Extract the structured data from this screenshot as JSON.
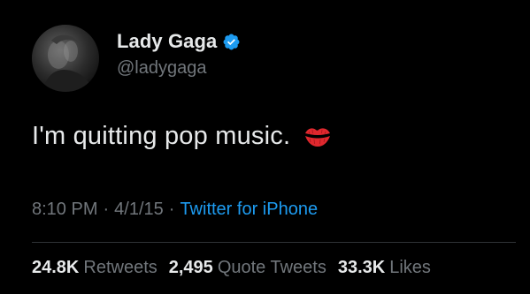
{
  "author": {
    "display_name": "Lady Gaga",
    "handle": "@ladygaga",
    "verified": true,
    "verified_badge_icon": "verified-checkmark-icon",
    "avatar_icon": "profile-avatar"
  },
  "tweet": {
    "text": "I'm quitting pop music.",
    "emoji_icon": "kiss-mark-icon"
  },
  "meta": {
    "time": "8:10 PM",
    "separator": "·",
    "date": "4/1/15",
    "source": "Twitter for iPhone"
  },
  "stats": {
    "retweets_count": "24.8K",
    "retweets_label": "Retweets",
    "quotes_count": "2,495",
    "quotes_label": "Quote Tweets",
    "likes_count": "33.3K",
    "likes_label": "Likes"
  },
  "colors": {
    "background": "#000000",
    "primary_text": "#e7e9ea",
    "secondary_text": "#71767b",
    "link": "#1d9bf0",
    "verified": "#1d9bf0",
    "divider": "#2f3336",
    "emoji_red": "#e0282e"
  }
}
